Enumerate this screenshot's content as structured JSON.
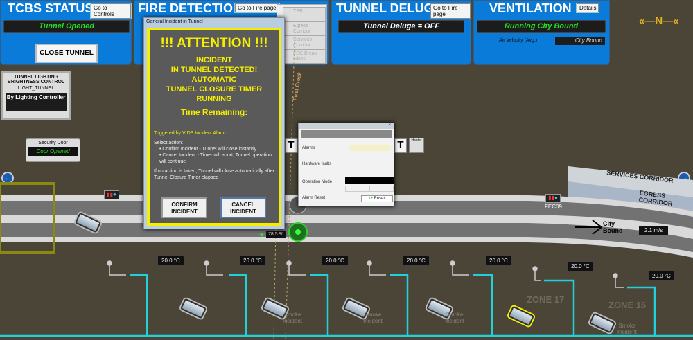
{
  "tcbs": {
    "title": "TCBS STATUS",
    "controls_btn": "Go to Controls",
    "status": "Tunnel Opened",
    "close_btn": "CLOSE TUNNEL"
  },
  "fire": {
    "title": "FIRE DETECTION",
    "fire_btn": "Go to Fire page",
    "list": [
      "TSB",
      "Egress Corridor",
      "Services Corridor",
      "FEC Break Glass"
    ]
  },
  "deluge": {
    "title": "TUNNEL DELUGE",
    "fire_btn": "Go to Fire page",
    "status": "Tunnel Deluge = OFF"
  },
  "ventilation": {
    "title": "VENTILATION",
    "details_btn": "Details",
    "status": "Running City Bound",
    "air_label": "Air Velocity (Avg.)",
    "air_value": "City Bound"
  },
  "compass": {
    "label": "N"
  },
  "lighting": {
    "title": "TUNNEL LIGHTING BRIGHTNESS CONTROL",
    "tag": "LIGHT_TUNNEL",
    "mode": "By Lighting Controller"
  },
  "security_door": {
    "label": "Security Door",
    "status": "Door Opened"
  },
  "creek": "First Creek",
  "dialog": {
    "window_title": "General Incident in Tunnel",
    "heading": "!!! ATTENTION !!!",
    "message": [
      "INCIDENT",
      "IN TUNNEL DETECTED!",
      "AUTOMATIC",
      "TUNNEL CLOSURE TIMER",
      "RUNNING"
    ],
    "time_label": "Time Remaining:",
    "trigger": "Triggered by VIDS Incident Alarm",
    "select": "Select action:",
    "bullets": [
      "Confirm Incident - Tunnel will close instantly",
      "Cancel Incident - Timer will abort, Tunnel operation will continue"
    ],
    "note": "If no action is taken, Tunnel will close automatically after Tunnel Closure Timer elapsed",
    "confirm": "CONFIRM INCIDENT",
    "cancel": "CANCEL INCIDENT"
  },
  "device": {
    "alarms": "Alarms",
    "faults": "Hardware faults",
    "mode": "Operation Mode",
    "reset_label": "Alarm Reset",
    "reset_btn": "Reset"
  },
  "heater": "Heater",
  "tunnel": {
    "fec": "FEC09",
    "services": "SERVICES CORRIDOR",
    "egress": "EGRESS CORRIDOR",
    "direction": "City Bound",
    "speed": "2.1 m/s",
    "fan_level": "78.5 %"
  },
  "temps": [
    "20.0 °C",
    "20.0 °C",
    "20.0 °C",
    "20.0 °C",
    "20.0 °C",
    "20.0 °C",
    "20.0 °C"
  ],
  "zones": [
    "ZONE 17",
    "ZONE 16"
  ],
  "smoke": "Smoke Incident",
  "colors": {
    "panel": "#0a7bd8",
    "pipe": "#22d0dc",
    "alert": "#f5ee00",
    "background": "#4a4536"
  }
}
